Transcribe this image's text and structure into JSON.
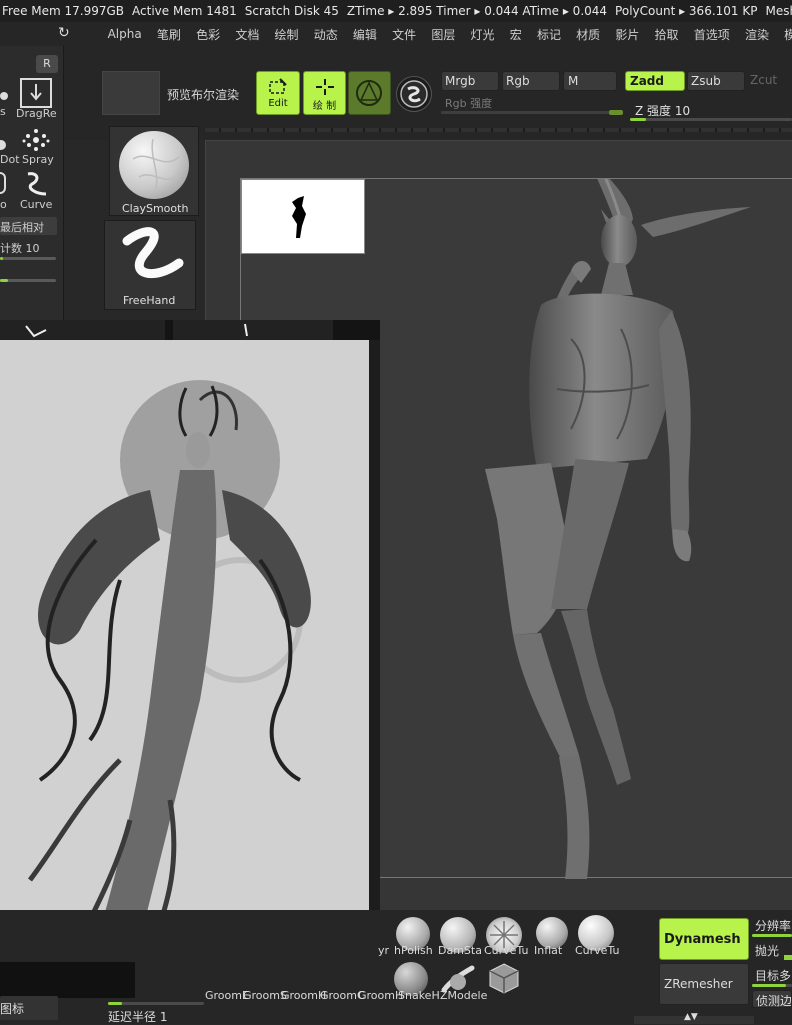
{
  "status_bar": {
    "free_mem": "Free Mem 17.997GB",
    "active_mem": "Active Mem 1481",
    "scratch_disk": "Scratch Disk 45",
    "ztime": "ZTime ▸ 2.895 Timer ▸ 0.044 ATime ▸ 0.044",
    "polycount": "PolyCount ▸ 366.101 KP",
    "meshcount": "MeshCoun"
  },
  "menu": {
    "items": [
      "Alpha",
      "笔刷",
      "色彩",
      "文档",
      "绘制",
      "动态",
      "编辑",
      "文件",
      "图层",
      "灯光",
      "宏",
      "标记",
      "材质",
      "影片",
      "拾取",
      "首选项",
      "渲染",
      "模板"
    ]
  },
  "left_panel": {
    "r_label": "R",
    "s_label": "s",
    "dragrect_label": "DragRe",
    "dot_label": "Dot",
    "spray_label": "Spray",
    "o_label": "o",
    "curve_label": "Curve",
    "relative_label": "最后相对",
    "count_label": "计数 10",
    "count_fill": 0.05,
    "second_fill": 0.15
  },
  "top_toolbar": {
    "preview_bool_label": "预览布尔渲染",
    "edit_label": "Edit",
    "draw_label": "绘 制",
    "mrgb_label": "Mrgb",
    "rgb_label": "Rgb",
    "m_label": "M",
    "rgb_intensity_label": "Rgb 强度",
    "zadd_label": "Zadd",
    "zsub_label": "Zsub",
    "zcut_label": "Zcut",
    "z_intensity_label": "Z 强度 10",
    "z_intensity_value": 0.1
  },
  "brush_tray": {
    "clay_label": "ClaySmooth",
    "freehand_label": "FreeHand"
  },
  "bottom_shelf": {
    "row1": [
      "yr",
      "hPolish",
      "DamSta",
      "CurveTu",
      "Inflat",
      "CurveTu"
    ],
    "row2": [
      "GroomE",
      "GroomS",
      "GroomH",
      "GroomC",
      "GroomH",
      "SnakeH",
      "ZModele"
    ],
    "dynamesh_label": "Dynamesh",
    "resolution_label": "分辨率",
    "polish_label": "抛光",
    "zremesher_label": "ZRemesher",
    "target_label": "目标多",
    "detect_edge_label": "侦测边缘",
    "delay_radius_label": "延迟半径 1",
    "icon_label": "图标"
  },
  "colors": {
    "accent": "#b7f34a",
    "panel": "#262626",
    "canvas": "#3a3a3a"
  }
}
